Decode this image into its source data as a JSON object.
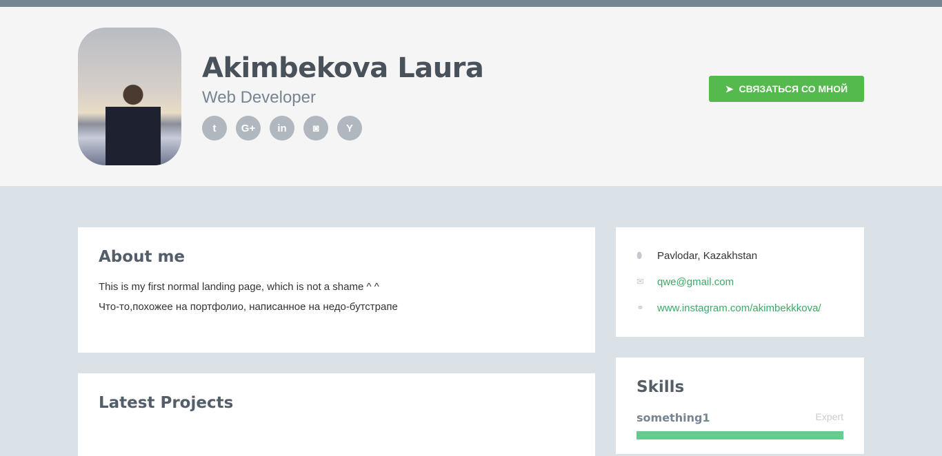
{
  "header": {
    "name": "Akimbekova Laura",
    "title": "Web Developer",
    "contact_button": "СВЯЗАТЬСЯ СО МНОЙ",
    "social": [
      {
        "icon": "twitter-icon",
        "glyph": "t"
      },
      {
        "icon": "google-plus-icon",
        "glyph": "G+"
      },
      {
        "icon": "linkedin-icon",
        "glyph": "in"
      },
      {
        "icon": "github-icon",
        "glyph": "◙"
      },
      {
        "icon": "hacker-news-icon",
        "glyph": "Y"
      }
    ]
  },
  "about": {
    "heading": "About me",
    "lines": [
      "This is my first normal landing page, which is not a shame ^ ^",
      "Что-то,похожее на портфолио, написанное на недо-бутстрапе"
    ]
  },
  "projects": {
    "heading": "Latest Projects"
  },
  "info": {
    "location": "Pavlodar, Kazakhstan",
    "email": "qwe@gmail.com",
    "website": "www.instagram.com/akimbekkkova/"
  },
  "skills": {
    "heading": "Skills",
    "items": [
      {
        "name": "something1",
        "level": "Expert",
        "percent": 100
      }
    ]
  },
  "colors": {
    "accent": "#54ba4e",
    "link": "#3aaa64",
    "bar": "#66cb8e"
  }
}
